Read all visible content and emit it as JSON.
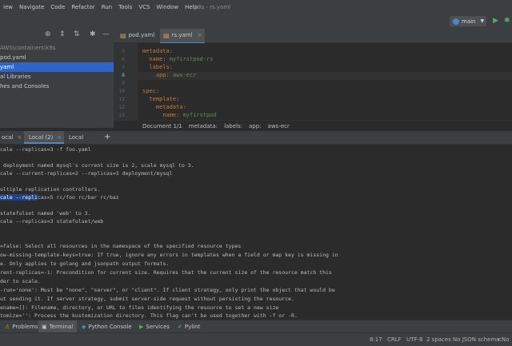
{
  "menu": [
    "iew",
    "Navigate",
    "Code",
    "Refactor",
    "Run",
    "Tools",
    "VCS",
    "Window",
    "Help"
  ],
  "window_title": "k8s - rs.yaml",
  "run_config": {
    "label": "main",
    "accent": "#4a86c8"
  },
  "project": {
    "tree": [
      {
        "label": "AWS\\containers\\k8s",
        "state": "dim"
      },
      {
        "label": "pod.yaml",
        "state": "normal"
      },
      {
        "label": "yaml",
        "state": "selected"
      },
      {
        "label": "al Libraries",
        "state": "normal"
      },
      {
        "label": "hes and Consoles",
        "state": "normal"
      }
    ]
  },
  "editor_tabs": [
    {
      "label": "pod.yaml",
      "active": false
    },
    {
      "label": "rs.yaml",
      "active": true
    }
  ],
  "editor": {
    "line_numbers": [
      "5",
      "6",
      "7",
      "8",
      "9",
      "10",
      "11",
      "12",
      "13"
    ],
    "current_line": "8",
    "lines": [
      {
        "key": "metadata:",
        "val": ""
      },
      {
        "key": "  name: ",
        "val": "myfirstpod-rs"
      },
      {
        "key": "  labels:",
        "val": ""
      },
      {
        "key": "    app: ",
        "val": "aws-ecr"
      },
      {
        "key": "",
        "val": ""
      },
      {
        "key": "spec:",
        "val": ""
      },
      {
        "key": "  template:",
        "val": ""
      },
      {
        "key": "    metadata:",
        "val": ""
      },
      {
        "key": "      name: ",
        "val": "myfirstpod"
      }
    ]
  },
  "breadcrumb": [
    "Document 1/1",
    "metadata:",
    "labels:",
    "app:",
    "aws-ecr"
  ],
  "terminal_tabs": [
    {
      "label": "ocal",
      "active": false
    },
    {
      "label": "Local (2)",
      "active": true
    },
    {
      "label": "Local (3)",
      "active": false
    }
  ],
  "terminal": {
    "lines": [
      {
        "pre": "cale --replicas=3 -f foo.yaml",
        "hl": "",
        "post": ""
      },
      {
        "pre": "",
        "hl": "",
        "post": ""
      },
      {
        "pre": " deployment named mysql's current size is 2, scale mysql to 3.",
        "hl": "",
        "post": ""
      },
      {
        "pre": "cale --current-replicas=2 --replicas=3 deployment/mysql",
        "hl": "",
        "post": ""
      },
      {
        "pre": "",
        "hl": "",
        "post": ""
      },
      {
        "pre": "ultiple replication controllers.",
        "hl": "",
        "post": ""
      },
      {
        "pre": "",
        "hl": "cale --repli",
        "post": "cas=5 rc/foo rc/bar rc/baz"
      },
      {
        "pre": "",
        "hl": "",
        "post": ""
      },
      {
        "pre": "statefulset named 'web' to 3.",
        "hl": "",
        "post": ""
      },
      {
        "pre": "cale --replicas=3 statefulset/web",
        "hl": "",
        "post": ""
      },
      {
        "pre": "",
        "hl": "",
        "post": ""
      },
      {
        "pre": "",
        "hl": "",
        "post": ""
      },
      {
        "pre": "=false: Select all resources in the namespace of the specified resource types",
        "hl": "",
        "post": ""
      },
      {
        "pre": "ow-missing-template-keys=true: If true, ignore any errors in templates when a field or map key is missing in",
        "hl": "",
        "post": ""
      },
      {
        "pre": "e. Only applies to golang and jsonpath output formats.",
        "hl": "",
        "post": ""
      },
      {
        "pre": "rent-replicas=-1: Precondition for current size. Requires that the current size of the resource match this",
        "hl": "",
        "post": ""
      },
      {
        "pre": "der to scale.",
        "hl": "",
        "post": ""
      },
      {
        "pre": "-run='none': Must be \"none\", \"server\", or \"client\". If client strategy, only print the object that would be",
        "hl": "",
        "post": ""
      },
      {
        "pre": "ut sending it. If server strategy, submit server-side request without persisting the resource.",
        "hl": "",
        "post": ""
      },
      {
        "pre": "ename=[]: Filename, directory, or URL to files identifying the resource to set a new size",
        "hl": "",
        "post": ""
      },
      {
        "pre": "tomize='': Process the kustomization directory. This flag can't be used together with -f or -R.",
        "hl": "",
        "post": ""
      }
    ]
  },
  "toolwindows": [
    {
      "label": "Problems",
      "icon": "problems-icon",
      "active": false
    },
    {
      "label": "Terminal",
      "icon": "terminal-icon",
      "active": true
    },
    {
      "label": "Python Console",
      "icon": "python-icon",
      "active": false
    },
    {
      "label": "Services",
      "icon": "services-icon",
      "active": false
    },
    {
      "label": "Pylint",
      "icon": "pylint-icon",
      "active": false
    }
  ],
  "status": {
    "position": "8:17",
    "line_sep": "CRLF",
    "encoding": "UTF-8",
    "indent": "2 spaces",
    "schema": "No JSON schema",
    "interpreter": "<No"
  }
}
